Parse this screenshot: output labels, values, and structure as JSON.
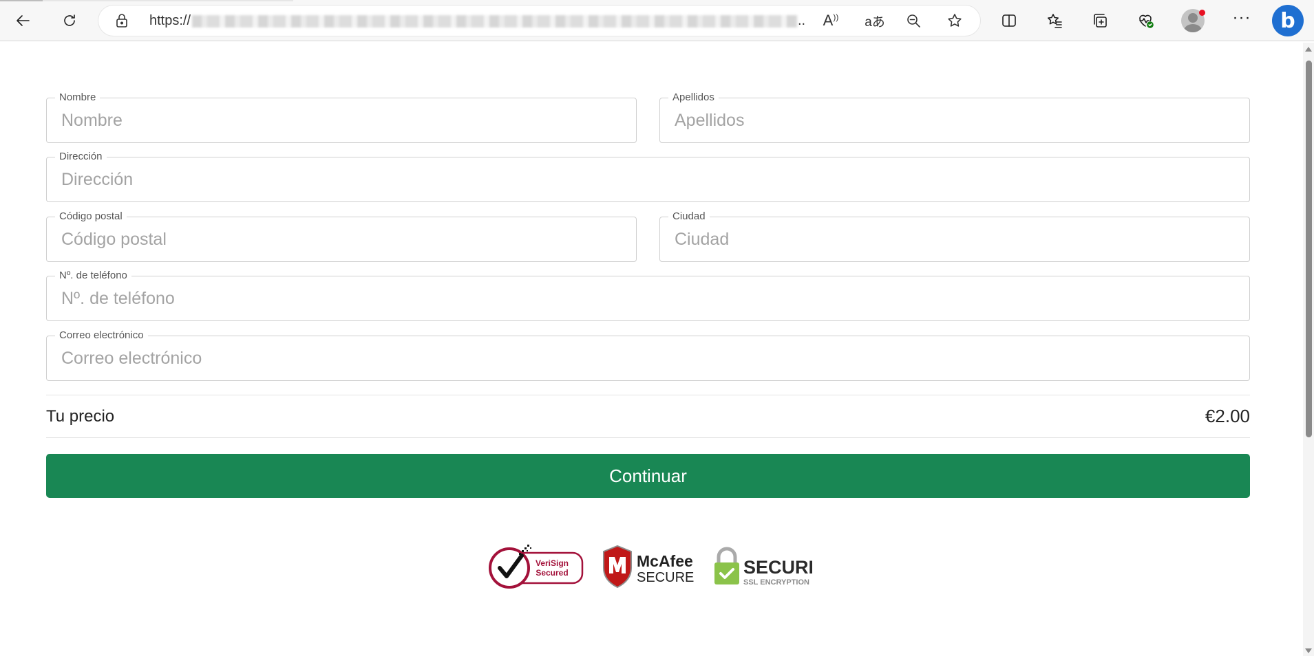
{
  "browser": {
    "url_prefix": "https://",
    "url_ellipsis": "..",
    "icons": {
      "back": "back-arrow-icon",
      "refresh": "refresh-icon",
      "lock": "lock-icon",
      "read_aloud": "read-aloud-icon",
      "translate": "translate-icon",
      "zoom_out": "zoom-out-icon",
      "favorite": "star-icon",
      "split_screen": "split-screen-icon",
      "favorites": "favorites-icon",
      "collections": "collections-icon",
      "health": "browser-essentials-icon",
      "profile": "profile-icon",
      "more": "more-icon",
      "copilot": "bing-icon"
    },
    "read_aloud_glyph": "A",
    "translate_glyph": "aあ",
    "more_glyph": "···",
    "bing_glyph": "b"
  },
  "form": {
    "nombre": {
      "label": "Nombre",
      "placeholder": "Nombre",
      "value": ""
    },
    "apellidos": {
      "label": "Apellidos",
      "placeholder": "Apellidos",
      "value": ""
    },
    "direccion": {
      "label": "Dirección",
      "placeholder": "Dirección",
      "value": ""
    },
    "codigo_postal": {
      "label": "Código postal",
      "placeholder": "Código postal",
      "value": ""
    },
    "ciudad": {
      "label": "Ciudad",
      "placeholder": "Ciudad",
      "value": ""
    },
    "telefono": {
      "label": "Nº. de teléfono",
      "placeholder": "Nº. de teléfono",
      "value": ""
    },
    "correo": {
      "label": "Correo electrónico",
      "placeholder": "Correo electrónico",
      "value": ""
    }
  },
  "summary": {
    "price_label": "Tu precio",
    "price_value": "€2.00"
  },
  "actions": {
    "continue_label": "Continuar"
  },
  "trust_badges": {
    "verisign_line1": "VeriSign",
    "verisign_line2": "Secured",
    "mcafee_line1": "McAfee",
    "mcafee_line2": "SECURE",
    "ssl_line1": "SECURE",
    "ssl_line2": "SSL ENCRYPTION"
  },
  "colors": {
    "primary_button": "#198754",
    "verisign_red": "#a3113a",
    "mcafee_red": "#c01818",
    "ssl_green": "#8bc34a"
  }
}
